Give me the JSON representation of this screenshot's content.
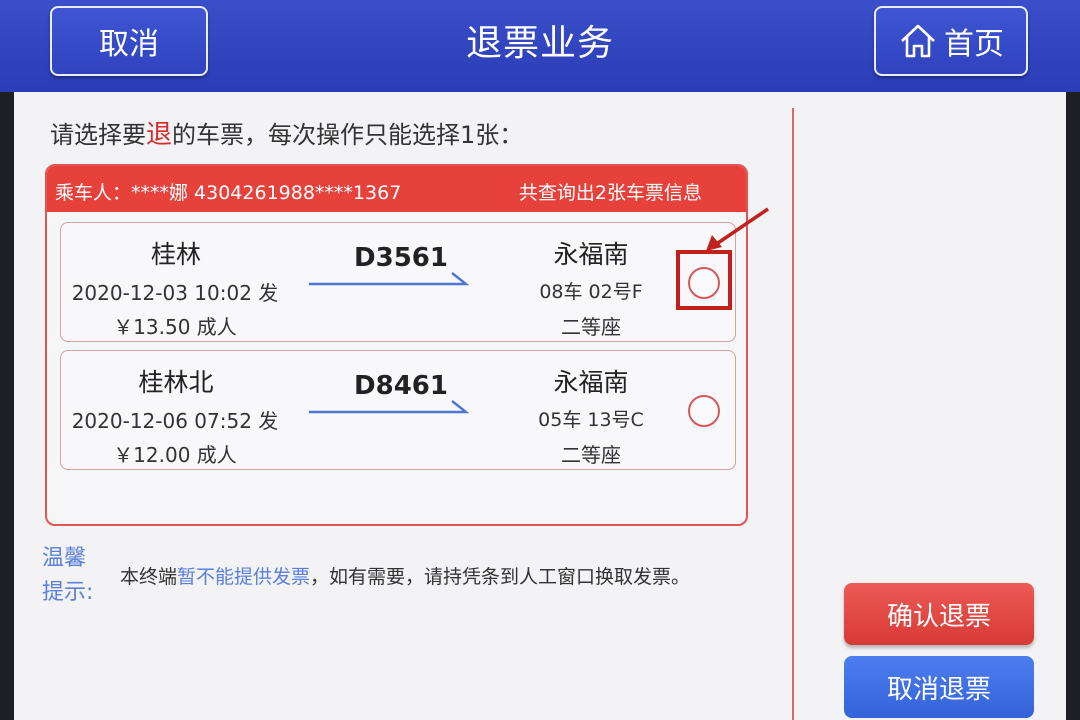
{
  "header": {
    "cancel_label": "取消",
    "title": "退票业务",
    "home_label": "首页"
  },
  "instruction": {
    "prefix": "请选择要",
    "highlight": "退",
    "suffix": "的车票，每次操作只能选择1张："
  },
  "panel": {
    "passenger": "乘车人：****娜 4304261988****1367",
    "query_count": "共查询出2张车票信息"
  },
  "tickets": [
    {
      "from": "桂林",
      "train_no": "D3561",
      "to": "永福南",
      "depart": "2020-12-03 10:02 发",
      "seat": "08车 02号F",
      "price": "￥13.50 成人",
      "seat_class": "二等座",
      "selected": false
    },
    {
      "from": "桂林北",
      "train_no": "D8461",
      "to": "永福南",
      "depart": "2020-12-06 07:52 发",
      "seat": "05车 13号C",
      "price": "￥12.00 成人",
      "seat_class": "二等座",
      "selected": false
    }
  ],
  "tips": {
    "label_line1": "温馨",
    "label_line2": "提示:",
    "text_prefix": "本终端",
    "text_highlight": "暂不能提供发票",
    "text_suffix": "，如有需要，请持凭条到人工窗口换取发票。"
  },
  "actions": {
    "confirm_label": "确认退票",
    "cancel_label": "取消退票"
  },
  "colors": {
    "header_blue": "#2f43bf",
    "accent_red": "#e6413b",
    "tip_blue": "#5b80d9",
    "cancel_blue": "#3562d8"
  },
  "icons": {
    "home": "home-icon",
    "radio": "radio-button",
    "arrow": "route-arrow-icon",
    "pointer": "annotation-arrow-icon"
  }
}
